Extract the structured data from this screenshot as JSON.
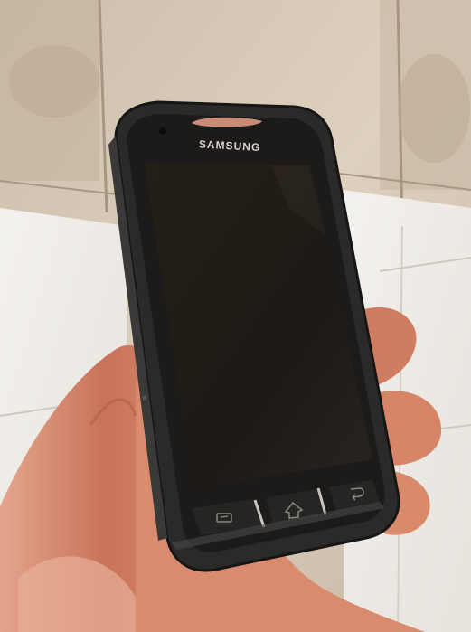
{
  "photo": {
    "subject": "phone",
    "brand_label": "SAMSUNG",
    "screen_state": "off",
    "hardware_keys": [
      {
        "name": "menu-key",
        "icon": "menu-icon"
      },
      {
        "name": "home-key",
        "icon": "home-icon"
      },
      {
        "name": "back-key",
        "icon": "back-icon"
      }
    ],
    "colors": {
      "tile_wall": "#d9cbb8",
      "grout": "#a89682",
      "counter": "#efece8",
      "phone_body": "#2a2a29",
      "screen": "#1d1a15",
      "earpiece": "#c98a76",
      "skin": "#c8735a"
    }
  }
}
